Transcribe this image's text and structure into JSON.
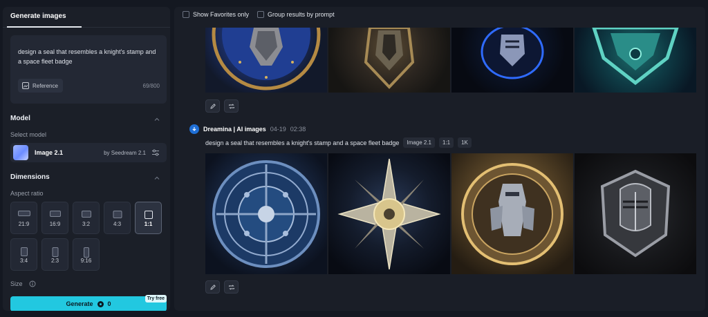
{
  "left_panel": {
    "tab_label": "Generate images",
    "prompt_text": "design a seal that resembles a knight's stamp and a space fleet badge",
    "reference_label": "Reference",
    "char_count": "69/800",
    "model_section": {
      "title": "Model",
      "subtitle": "Select model",
      "model_name": "Image 2.1",
      "model_by": "by Seedream 2.1"
    },
    "dimensions_section": {
      "title": "Dimensions",
      "subtitle": "Aspect ratio",
      "ratios": [
        "21:9",
        "16:9",
        "3:2",
        "4:3",
        "1:1",
        "3:4",
        "2:3",
        "9:16"
      ],
      "selected_ratio": "1:1"
    },
    "size_label": "Size",
    "generate_label": "Generate",
    "generate_cost": "0",
    "try_free_label": "Try free"
  },
  "right_panel": {
    "filters": {
      "show_favorites": "Show Favorites only",
      "group_by_prompt": "Group results by prompt"
    },
    "generation": {
      "author": "Dreamina | AI images",
      "date": "04-19",
      "time": "02:38",
      "prompt": "design a seal that resembles a knight's stamp and a space fleet badge",
      "tags": [
        "Image 2.1",
        "1:1",
        "1K"
      ]
    }
  },
  "colors": {
    "accent": "#22c8e0",
    "panel_bg": "#1b1f28",
    "page_bg": "#141821"
  }
}
